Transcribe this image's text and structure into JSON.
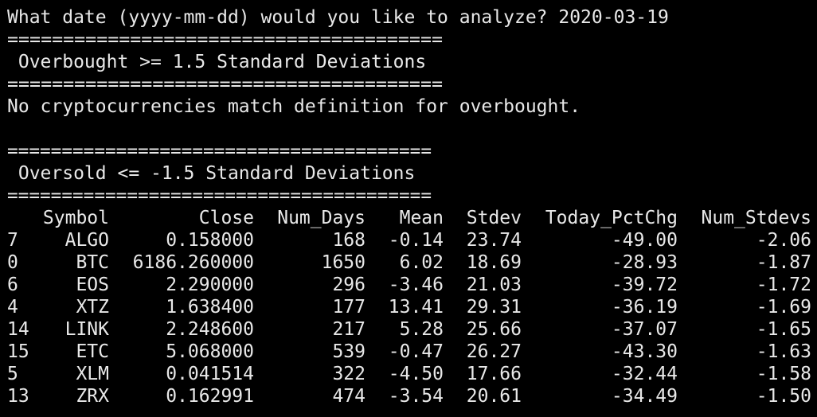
{
  "prompt": {
    "question": "What date (yyyy-mm-dd) would you like to analyze? ",
    "answer": "2020-03-19"
  },
  "separator": "=======================================",
  "overbought": {
    "title": " Overbought >= 1.5 Standard Deviations",
    "message": "No cryptocurrencies match definition for overbought."
  },
  "oversold": {
    "title": " Oversold <= -1.5 Standard Deviations",
    "columns": [
      "",
      "Symbol",
      "Close",
      "Num_Days",
      "Mean",
      "Stdev",
      "Today_PctChg",
      "Num_Stdevs"
    ],
    "rows": [
      [
        "7",
        "ALGO",
        "0.158000",
        "168",
        "-0.14",
        "23.74",
        "-49.00",
        "-2.06"
      ],
      [
        "0",
        "BTC",
        "6186.260000",
        "1650",
        "6.02",
        "18.69",
        "-28.93",
        "-1.87"
      ],
      [
        "6",
        "EOS",
        "2.290000",
        "296",
        "-3.46",
        "21.03",
        "-39.72",
        "-1.72"
      ],
      [
        "4",
        "XTZ",
        "1.638400",
        "177",
        "13.41",
        "29.31",
        "-36.19",
        "-1.69"
      ],
      [
        "14",
        "LINK",
        "2.248600",
        "217",
        "5.28",
        "25.66",
        "-37.07",
        "-1.65"
      ],
      [
        "15",
        "ETC",
        "5.068000",
        "539",
        "-0.47",
        "26.27",
        "-43.30",
        "-1.63"
      ],
      [
        "5",
        "XLM",
        "0.041514",
        "322",
        "-4.50",
        "17.66",
        "-32.44",
        "-1.58"
      ],
      [
        "13",
        "ZRX",
        "0.162991",
        "474",
        "-3.54",
        "20.61",
        "-34.49",
        "-1.50"
      ]
    ]
  }
}
